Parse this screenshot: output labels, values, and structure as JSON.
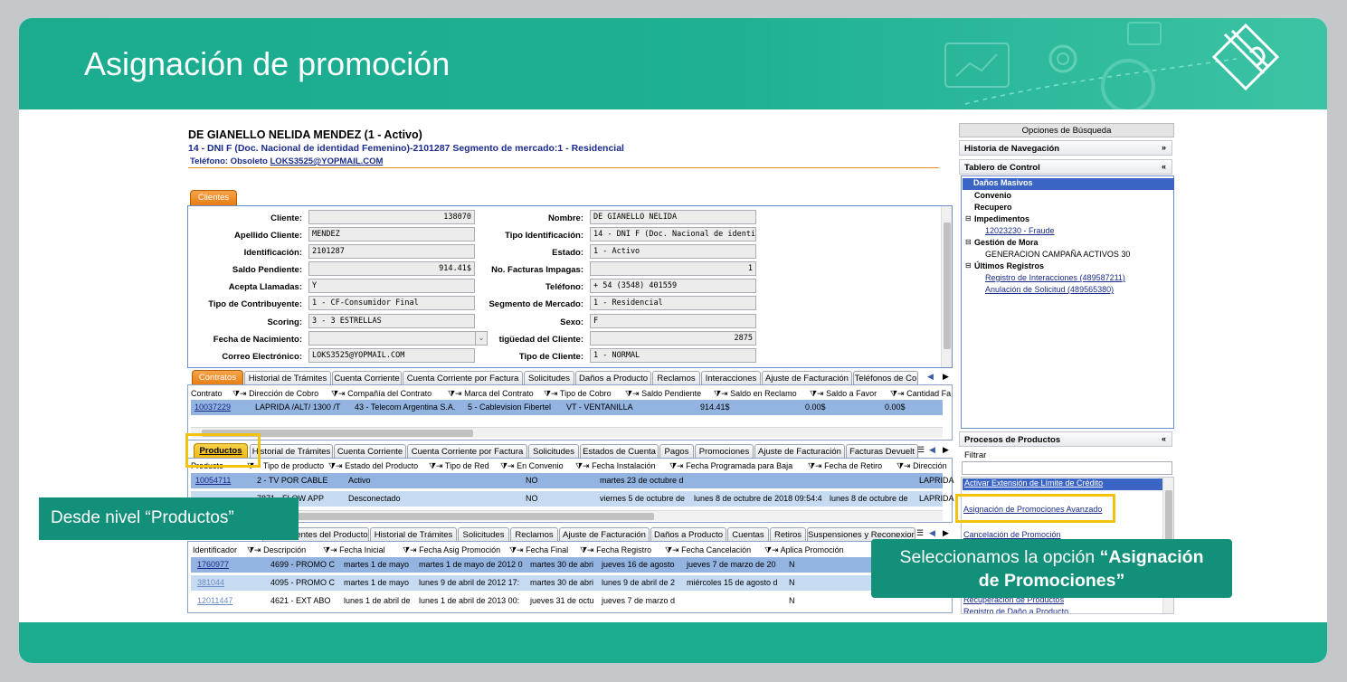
{
  "slide": {
    "title": "Asignación de promoción"
  },
  "customer": {
    "name": "DE GIANELLO NELIDA  MENDEZ (1 - Activo)",
    "line2": "14 - DNI F (Doc. Nacional de identidad Femenino)-2101287 Segmento de mercado:1 - Residencial",
    "phone_label": "Teléfono: Obsoleto",
    "email": "LOKS3525@YOPMAIL.COM"
  },
  "clientes_tab": "Clientes",
  "fields": [
    {
      "label": "Cliente:",
      "value": "138070",
      "align": "r"
    },
    {
      "label": "Apellido Cliente:",
      "value": "MENDEZ"
    },
    {
      "label": "Identificación:",
      "value": "2101287"
    },
    {
      "label": "Saldo Pendiente:",
      "value": "914.41$",
      "align": "r"
    },
    {
      "label": "Acepta Llamadas:",
      "value": "Y"
    },
    {
      "label": "Tipo de Contribuyente:",
      "value": "1 - CF-Consumidor Final"
    },
    {
      "label": "Scoring:",
      "value": "3 - 3 ESTRELLAS"
    },
    {
      "label": "Fecha de Nacimiento:",
      "value": ""
    },
    {
      "label": "Correo Electrónico:",
      "value": "LOKS3525@YOPMAIL.COM"
    }
  ],
  "fields_right": [
    {
      "label": "Nombre:",
      "value": "DE GIANELLO NELIDA"
    },
    {
      "label": "Tipo Identificación:",
      "value": "14 - DNI F (Doc. Nacional de identidad"
    },
    {
      "label": "Estado:",
      "value": "1 - Activo"
    },
    {
      "label": "No. Facturas Impagas:",
      "value": "1",
      "align": "r"
    },
    {
      "label": "Teléfono:",
      "value": "+ 54 (3548) 401559"
    },
    {
      "label": "Segmento de Mercado:",
      "value": "1 - Residencial"
    },
    {
      "label": "Sexo:",
      "value": "F"
    },
    {
      "label": "tigüedad del Cliente:",
      "value": "2875",
      "align": "r"
    },
    {
      "label": "Tipo de Cliente:",
      "value": "1 - NORMAL"
    }
  ],
  "contract_tabs": [
    "Contratos",
    "Historial de Trámites",
    "Cuenta Corriente",
    "Cuenta Corriente por Factura",
    "Solicitudes",
    "Daños a Producto",
    "Reclamos",
    "Interacciones",
    "Ajuste de Facturación",
    "Teléfonos de Co"
  ],
  "contract_cols": [
    "Contrato",
    "Dirección de Cobro",
    "Compañía del Contrato",
    "Marca del Contrato",
    "Tipo de Cobro",
    "Saldo Pendiente",
    "Saldo en Reclamo",
    "Saldo a Favor",
    "Cantidad Fa"
  ],
  "contract_row": [
    "10037229",
    "LAPRIDA /ALT/ 1300 /T",
    "43 - Telecom Argentina S.A.",
    "5 - Cablevision Fibertel",
    "VT - VENTANILLA",
    "914.41$",
    "0.00$",
    "0.00$"
  ],
  "product_tabs": [
    "Productos",
    "Historial de Trámites",
    "Cuenta Corriente",
    "Cuenta Corriente por Factura",
    "Solicitudes",
    "Estados de Cuenta",
    "Pagos",
    "Promociones",
    "Ajuste de Facturación",
    "Facturas Devuelt"
  ],
  "product_cols": [
    "Producto",
    "Tipo de producto",
    "Estado del Producto",
    "Tipo de Red",
    "En Convenio",
    "Fecha Instalación",
    "Fecha Programada para Baja",
    "Fecha de Retiro",
    "Dirección"
  ],
  "product_rows": [
    [
      "10054711",
      "2 - TV POR CABLE",
      "Activo",
      "",
      "NO",
      "martes 23 de octubre d",
      "",
      "",
      "LAPRIDA"
    ],
    [
      "",
      "7871 - FLOW APP",
      "Desconectado",
      "",
      "NO",
      "viernes 5 de octubre de",
      "lunes 8 de octubre de 2018 09:54:4",
      "lunes 8 de octubre de",
      "LAPRIDA"
    ]
  ],
  "promo_tabs": [
    "Componentes del Producto",
    "Historial de Trámites",
    "Solicitudes",
    "Reclamos",
    "Ajuste de Facturación",
    "Daños a Producto",
    "Cuentas",
    "Retiros",
    "Suspensiones y Reconexion"
  ],
  "promo_cols": [
    "Identificador",
    "Descripción",
    "Fecha Inicial",
    "Fecha Asig Promoción",
    "Fecha Final",
    "Fecha Registro",
    "Fecha Cancelación",
    "Aplica Promoción"
  ],
  "promo_rows": [
    [
      "1760977",
      "4699 - PROMO C",
      "martes 1 de mayo",
      "martes 1 de mayo de 2012 0",
      "martes 30 de abri",
      "jueves 16 de agosto",
      "jueves 7 de marzo de 20",
      "N"
    ],
    [
      "381044",
      "4095 - PROMO C",
      "martes 1 de mayo",
      "lunes 9 de abril de 2012 17:",
      "martes 30 de abri",
      "lunes 9 de abril de 2",
      "miércoles 15 de agosto d",
      "N"
    ],
    [
      "12011447",
      "4621 - EXT ABO",
      "lunes 1 de abril de",
      "lunes 1 de abril de 2013 00:",
      "jueves 31 de octu",
      "jueves 7 de marzo d",
      "",
      "N"
    ]
  ],
  "sidebar": {
    "title": "Opciones de Búsqueda",
    "sec_history": "Historia de Navegación",
    "sec_board": "Tablero de Control",
    "tree": {
      "danos": "Daños Masivos",
      "convenio": "Convenio",
      "recupero": "Recupero",
      "impedimentos": "Impedimentos",
      "imp_item": "12023230 - Fraude",
      "mora": "Gestión de Mora",
      "mora_item": "GENERACION CAMPAÑA ACTIVOS 30",
      "ultimos": "Últimos Registros",
      "ult_1": "Registro de Interacciones (489587211)",
      "ult_2": "Anulación de Solicitud (489565380)"
    },
    "sec_procesos": "Procesos de Productos",
    "filter_label": "Filtrar",
    "processes": [
      "Activar Extensión de Límite de Crédito",
      "Asignación de Promociones Avanzado",
      "Cancelación de Promoción",
      "Recuperación de Productos",
      "Registro de Daño a Producto"
    ]
  },
  "callouts": {
    "left": "Desde nivel “Productos”",
    "right_prefix": "Seleccionamos la opción ",
    "right_bold_1": "“Asignación",
    "right_bold_2": "de Promociones”"
  }
}
